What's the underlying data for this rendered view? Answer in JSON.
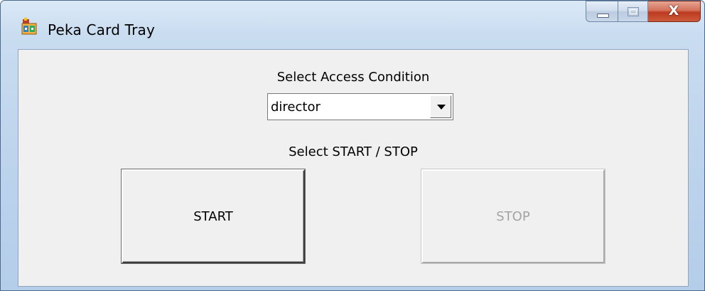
{
  "window": {
    "title": "Peka Card Tray",
    "icon": "app-card-icon",
    "caption_buttons": {
      "minimize_icon": "minimize-icon",
      "maximize_icon": "maximize-icon",
      "close_glyph": "X"
    }
  },
  "form": {
    "access_label": "Select Access Condition",
    "access_select": {
      "selected_value": "director",
      "arrow_icon": "dropdown-arrow-icon"
    },
    "startstop_label": "Select START / STOP",
    "start_button": {
      "label": "START",
      "enabled": true
    },
    "stop_button": {
      "label": "STOP",
      "enabled": false
    }
  },
  "colors": {
    "close_button": "#c4452a",
    "client_background": "#f0f0f0",
    "disabled_text": "#a3a3a3"
  }
}
